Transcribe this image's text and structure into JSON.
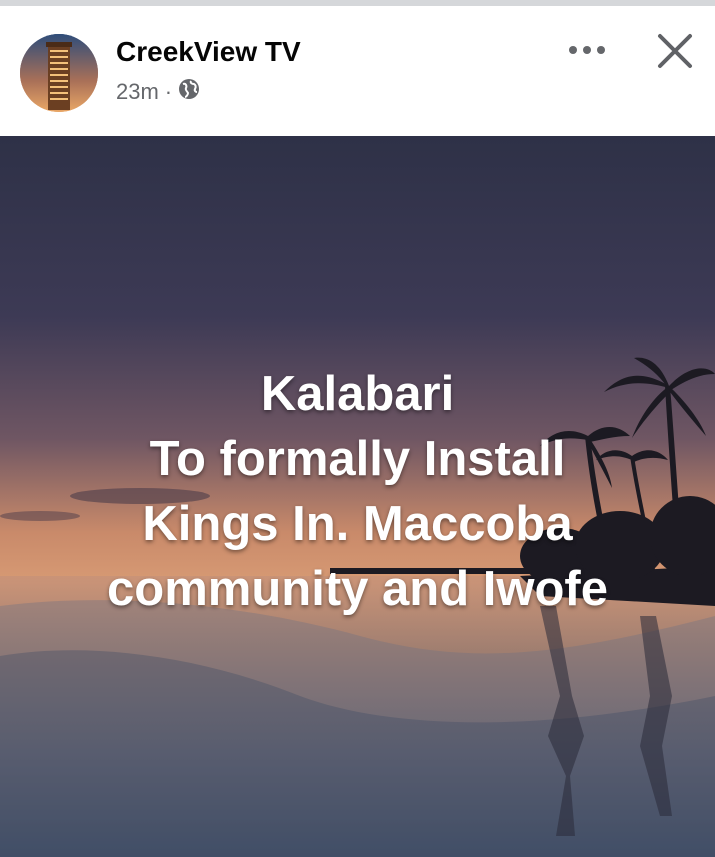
{
  "post": {
    "author": "CreekView TV",
    "timestamp": "23m",
    "separator": "·",
    "audience_icon": "globe-icon",
    "more_icon": "more-options-icon",
    "close_icon": "close-icon",
    "text_lines": [
      "Kalabari",
      "To formally Install",
      "Kings In. Maccoba",
      "community and Iwofe"
    ]
  },
  "colors": {
    "name_text": "#050505",
    "meta_text": "#65676b",
    "overlay_text": "#ffffff"
  }
}
